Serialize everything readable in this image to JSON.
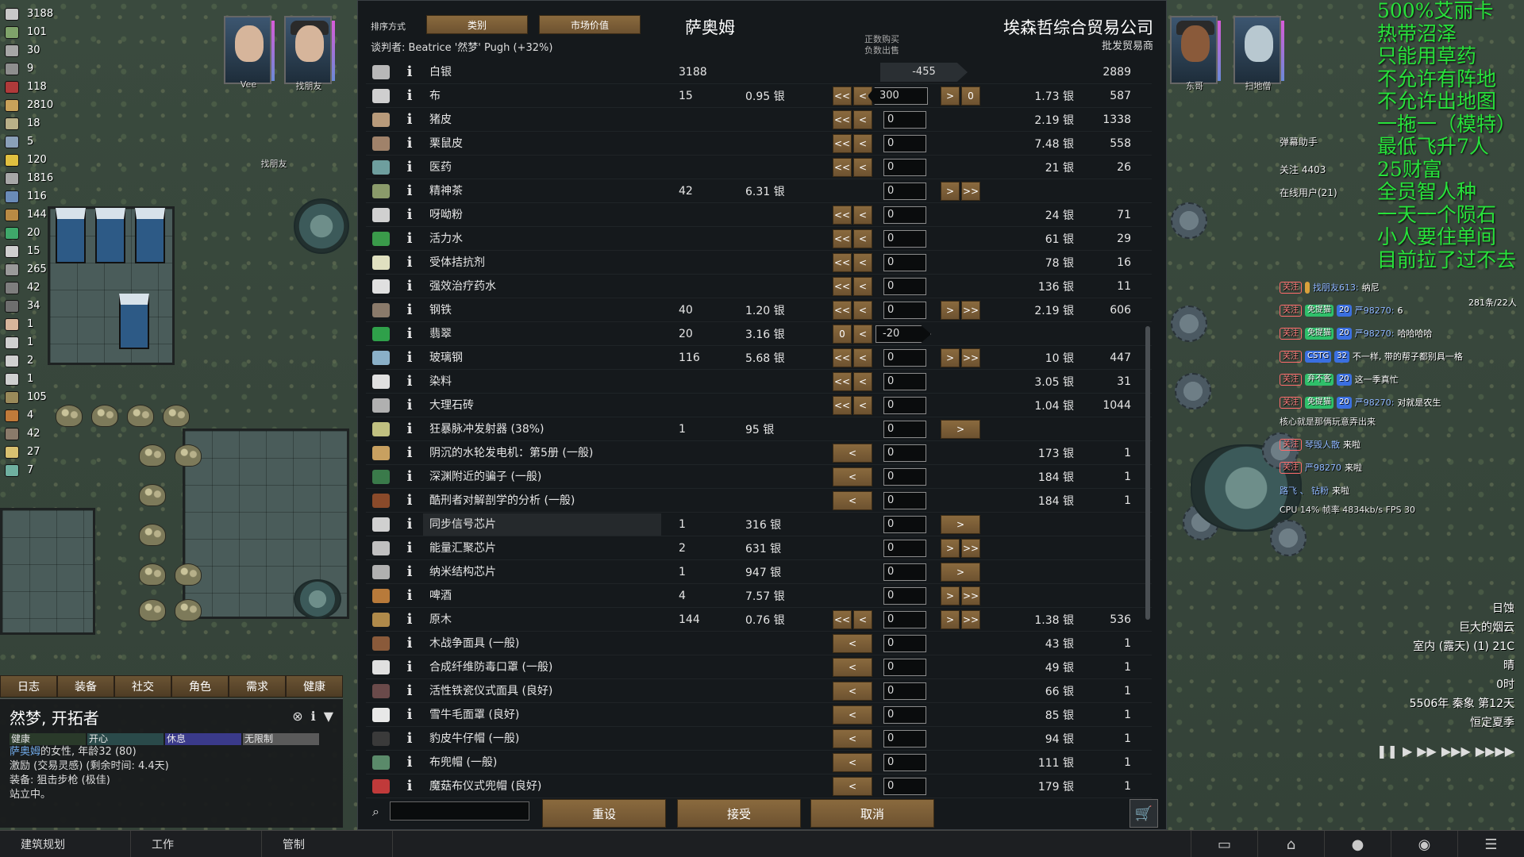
{
  "resources": [
    {
      "value": "3188",
      "color": "#c8c8c8"
    },
    {
      "value": "101",
      "color": "#7fa36a"
    },
    {
      "value": "30",
      "color": "#a6a6a6"
    },
    {
      "value": "9",
      "color": "#8e8e8e"
    },
    {
      "value": "118",
      "color": "#b03a3a"
    },
    {
      "value": "2810",
      "color": "#c9a25a"
    },
    {
      "value": "18",
      "color": "#b9b088"
    },
    {
      "value": "5",
      "color": "#8aa0b8"
    },
    {
      "value": "120",
      "color": "#e0c040"
    },
    {
      "value": "1816",
      "color": "#a7a7a7"
    },
    {
      "value": "116",
      "color": "#6a8bb8"
    },
    {
      "value": "144",
      "color": "#b98a44"
    },
    {
      "value": "20",
      "color": "#3fa86a"
    },
    {
      "value": "15",
      "color": "#cfcfcf"
    },
    {
      "value": "265",
      "color": "#9a9a9a"
    },
    {
      "value": "42",
      "color": "#7e7e7e"
    },
    {
      "value": "34",
      "color": "#6e6e6e"
    },
    {
      "value": "1",
      "color": "#d6b59b"
    },
    {
      "value": "1",
      "color": "#d0d0d0"
    },
    {
      "value": "2",
      "color": "#d0d0d0"
    },
    {
      "value": "1",
      "color": "#d0d0d0"
    },
    {
      "value": "105",
      "color": "#9a8a5a"
    },
    {
      "value": "4",
      "color": "#c07a3a"
    },
    {
      "value": "42",
      "color": "#8a7a6a"
    },
    {
      "value": "27",
      "color": "#d8c070"
    },
    {
      "value": "7",
      "color": "#6fb0a0"
    }
  ],
  "colonists_left": [
    {
      "name": "Vee"
    },
    {
      "name": "找朋友"
    }
  ],
  "colonists_right": [
    {
      "name": "东哥"
    },
    {
      "name": "扫地僧"
    }
  ],
  "map_label": "找朋友",
  "trade": {
    "sort_label": "排序方式",
    "sort_category": "类别",
    "sort_market": "市场价值",
    "negotiator": "谈判者: Beatrice '然梦' Pugh (+32%)",
    "left_title": "萨奥姆",
    "right_title": "埃森哲综合贸易公司",
    "right_sub": "批发贸易商",
    "hint_buy": "正数购买",
    "hint_sell": "负数出售",
    "currency": {
      "name": "白银",
      "count": "3188",
      "qty": "-455",
      "trader_count": "2889"
    },
    "rows": [
      {
        "name": "布",
        "count": "15",
        "price": "0.95 银",
        "qty": "300",
        "rprice": "1.73 银",
        "rcount": "587",
        "color": "#cfcfcf",
        "buttons": "full",
        "right_buttons": "one-zero",
        "qty_style": "pos"
      },
      {
        "name": "猪皮",
        "count": "",
        "price": "",
        "qty": "0",
        "rprice": "2.19 银",
        "rcount": "1338",
        "color": "#b89a7a",
        "buttons": "full",
        "right_buttons": "none"
      },
      {
        "name": "栗鼠皮",
        "count": "",
        "price": "",
        "qty": "0",
        "rprice": "7.48 银",
        "rcount": "558",
        "color": "#a0826a",
        "buttons": "full",
        "right_buttons": "none"
      },
      {
        "name": "医药",
        "count": "",
        "price": "",
        "qty": "0",
        "rprice": "21 银",
        "rcount": "26",
        "color": "#6e9e9e",
        "buttons": "full",
        "right_buttons": "none"
      },
      {
        "name": "精神茶",
        "count": "42",
        "price": "6.31 银",
        "qty": "0",
        "rprice": "",
        "rcount": "",
        "color": "#8a9a6a",
        "buttons": "none",
        "right_buttons": "two"
      },
      {
        "name": "呀呦粉",
        "count": "",
        "price": "",
        "qty": "0",
        "rprice": "24 银",
        "rcount": "71",
        "color": "#d0d0d0",
        "buttons": "full",
        "right_buttons": "none"
      },
      {
        "name": "活力水",
        "count": "",
        "price": "",
        "qty": "0",
        "rprice": "61 银",
        "rcount": "29",
        "color": "#3a9a4a",
        "buttons": "full",
        "right_buttons": "none"
      },
      {
        "name": "受体拮抗剂",
        "count": "",
        "price": "",
        "qty": "0",
        "rprice": "78 银",
        "rcount": "16",
        "color": "#e0e0c0",
        "buttons": "full",
        "right_buttons": "none"
      },
      {
        "name": "强效治疗药水",
        "count": "",
        "price": "",
        "qty": "0",
        "rprice": "136 银",
        "rcount": "11",
        "color": "#e0e0e0",
        "buttons": "full",
        "right_buttons": "none"
      },
      {
        "name": "钢铁",
        "count": "40",
        "price": "1.20 银",
        "qty": "0",
        "rprice": "2.19 银",
        "rcount": "606",
        "color": "#8a7a6a",
        "buttons": "full",
        "right_buttons": "two"
      },
      {
        "name": "翡翠",
        "count": "20",
        "price": "3.16 银",
        "qty": "-20",
        "rprice": "",
        "rcount": "",
        "color": "#2fa04a",
        "buttons": "zero-one",
        "right_buttons": "none",
        "qty_style": "neg"
      },
      {
        "name": "玻璃钢",
        "count": "116",
        "price": "5.68 银",
        "qty": "0",
        "rprice": "10 银",
        "rcount": "447",
        "color": "#8ab0c8",
        "buttons": "full",
        "right_buttons": "two"
      },
      {
        "name": "染料",
        "count": "",
        "price": "",
        "qty": "0",
        "rprice": "3.05 银",
        "rcount": "31",
        "color": "#e0e0e0",
        "buttons": "full",
        "right_buttons": "none"
      },
      {
        "name": "大理石砖",
        "count": "",
        "price": "",
        "qty": "0",
        "rprice": "1.04 银",
        "rcount": "1044",
        "color": "#b0b0b0",
        "buttons": "full",
        "right_buttons": "none"
      },
      {
        "name": "狂暴脉冲发射器 (38%)",
        "count": "1",
        "price": "95 银",
        "qty": "0",
        "rprice": "",
        "rcount": "",
        "color": "#c0c080",
        "buttons": "none",
        "right_buttons": "single"
      },
      {
        "name": "阴沉的水轮发电机：第5册 (一般)",
        "count": "",
        "price": "",
        "qty": "0",
        "rprice": "173 银",
        "rcount": "1",
        "color": "#c8a060",
        "buttons": "single",
        "right_buttons": "none"
      },
      {
        "name": "深渊附近的骗子 (一般)",
        "count": "",
        "price": "",
        "qty": "0",
        "rprice": "184 银",
        "rcount": "1",
        "color": "#3a7a4a",
        "buttons": "single",
        "right_buttons": "none"
      },
      {
        "name": "酷刑者对解剖学的分析 (一般)",
        "count": "",
        "price": "",
        "qty": "0",
        "rprice": "184 银",
        "rcount": "1",
        "color": "#8a4a2a",
        "buttons": "single",
        "right_buttons": "none"
      },
      {
        "name": "同步信号芯片",
        "count": "1",
        "price": "316 银",
        "qty": "0",
        "rprice": "",
        "rcount": "",
        "color": "#d0d0d0",
        "buttons": "none",
        "right_buttons": "single",
        "highlight": true
      },
      {
        "name": "能量汇聚芯片",
        "count": "2",
        "price": "631 银",
        "qty": "0",
        "rprice": "",
        "rcount": "",
        "color": "#c0c0c0",
        "buttons": "none",
        "right_buttons": "two"
      },
      {
        "name": "纳米结构芯片",
        "count": "1",
        "price": "947 银",
        "qty": "0",
        "rprice": "",
        "rcount": "",
        "color": "#b0b0b0",
        "buttons": "none",
        "right_buttons": "single"
      },
      {
        "name": "啤酒",
        "count": "4",
        "price": "7.57 银",
        "qty": "0",
        "rprice": "",
        "rcount": "",
        "color": "#b87a3a",
        "buttons": "none",
        "right_buttons": "two"
      },
      {
        "name": "原木",
        "count": "144",
        "price": "0.76 银",
        "qty": "0",
        "rprice": "1.38 银",
        "rcount": "536",
        "color": "#b08a4a",
        "buttons": "full",
        "right_buttons": "two"
      },
      {
        "name": "木战争面具 (一般)",
        "count": "",
        "price": "",
        "qty": "0",
        "rprice": "43 银",
        "rcount": "1",
        "color": "#8a5a3a",
        "buttons": "single",
        "right_buttons": "none"
      },
      {
        "name": "合成纤维防毒口罩 (一般)",
        "count": "",
        "price": "",
        "qty": "0",
        "rprice": "49 银",
        "rcount": "1",
        "color": "#e0e0e0",
        "buttons": "single",
        "right_buttons": "none"
      },
      {
        "name": "活性铁瓷仪式面具 (良好)",
        "count": "",
        "price": "",
        "qty": "0",
        "rprice": "66 银",
        "rcount": "1",
        "color": "#6a4a4a",
        "buttons": "single",
        "right_buttons": "none"
      },
      {
        "name": "雪牛毛面罩 (良好)",
        "count": "",
        "price": "",
        "qty": "0",
        "rprice": "85 银",
        "rcount": "1",
        "color": "#e8e8e8",
        "buttons": "single",
        "right_buttons": "none"
      },
      {
        "name": "豹皮牛仔帽 (一般)",
        "count": "",
        "price": "",
        "qty": "0",
        "rprice": "94 银",
        "rcount": "1",
        "color": "#3a3a3a",
        "buttons": "single",
        "right_buttons": "none"
      },
      {
        "name": "布兜帽 (一般)",
        "count": "",
        "price": "",
        "qty": "0",
        "rprice": "111 银",
        "rcount": "1",
        "color": "#5a8a6a",
        "buttons": "single",
        "right_buttons": "none"
      },
      {
        "name": "魔菇布仪式兜帽 (良好)",
        "count": "",
        "price": "",
        "qty": "0",
        "rprice": "179 银",
        "rcount": "1",
        "color": "#c03a3a",
        "buttons": "single",
        "right_buttons": "none"
      }
    ],
    "btn_reset": "重设",
    "btn_accept": "接受",
    "btn_cancel": "取消",
    "btn_left_all": "<<",
    "btn_left_one": "<",
    "btn_right_one": ">",
    "btn_right_all": ">>",
    "btn_zero": "0"
  },
  "inspect": {
    "tabs": [
      "日志",
      "装备",
      "社交",
      "角色",
      "需求",
      "健康"
    ],
    "name": "然梦, 开拓者",
    "needs": [
      {
        "label": "健康",
        "color": "#2a3a2a"
      },
      {
        "label": "开心",
        "color": "#2a4a4a"
      },
      {
        "label": "休息",
        "color": "#3a3a8a"
      },
      {
        "label": "无限制",
        "color": "#5a5a5a"
      }
    ],
    "line1_prefix": "萨奥姆",
    "line1_rest": "的女性, 年龄32 (80)",
    "line2": "激励 (交易灵感) (剩余时间: 4.4天)",
    "line3": "装备: 狙击步枪 (极佳)",
    "line4": "站立中。"
  },
  "mainbar": {
    "tabs": [
      "建筑规划",
      "工作",
      "管制"
    ]
  },
  "overlay_lines": [
    "500%艾丽卡",
    "热带沼泽",
    "只能用草药",
    "不允许有阵地",
    "不允许出地图",
    "一拖一（模特）",
    "最低飞升7人",
    "25财富",
    "全员智人种",
    "一天一个陨石",
    "小人要住单间",
    "目前拉了过不去"
  ],
  "chat": {
    "title": "弹幕助手",
    "follow": "关注 4403",
    "online": "在线用户(21)",
    "count_badge": "281条/22人",
    "messages": [
      {
        "chips": [
          {
            "t": "关注",
            "c": "red"
          },
          {
            "t": "",
            "c": "orange"
          }
        ],
        "user": "找朋友613:",
        "text": "纳尼"
      },
      {
        "chips": [
          {
            "t": "关注",
            "c": "red"
          },
          {
            "t": "免提猫",
            "c": "green"
          },
          {
            "t": "20",
            "c": "blue"
          }
        ],
        "user": "严98270:",
        "text": "6"
      },
      {
        "chips": [
          {
            "t": "关注",
            "c": "red"
          },
          {
            "t": "免提猫",
            "c": "green"
          },
          {
            "t": "20",
            "c": "blue"
          }
        ],
        "user": "严98270:",
        "text": "哈哈哈哈"
      },
      {
        "chips": [
          {
            "t": "关注",
            "c": "red"
          },
          {
            "t": "CSTG",
            "c": "blue"
          },
          {
            "t": "32",
            "c": "blue"
          }
        ],
        "user": "",
        "text": "不一样, 带的帮子都别具一格"
      },
      {
        "chips": [
          {
            "t": "关注",
            "c": "red"
          },
          {
            "t": "弃不客",
            "c": "green"
          },
          {
            "t": "20",
            "c": "blue"
          }
        ],
        "user": "",
        "text": "这一季真忙"
      },
      {
        "chips": [
          {
            "t": "关注",
            "c": "red"
          },
          {
            "t": "免提猫",
            "c": "green"
          },
          {
            "t": "20",
            "c": "blue"
          }
        ],
        "user": "严98270:",
        "text": "对就是农生"
      },
      {
        "chips": [
          {
            "t": "关注",
            "c": "red"
          }
        ],
        "user": "琴毁人散",
        "text": "来啦"
      },
      {
        "chips": [
          {
            "t": "关注",
            "c": "red"
          }
        ],
        "user": "严98270",
        "text": "来啦"
      },
      {
        "chips": [],
        "user": "路飞 、 钻粉",
        "text": "来啦"
      }
    ],
    "note1": "核心就是那俩玩意弄出来",
    "note2": "CPU 14%  帧率 4834kb/s FPS 30"
  },
  "weather": {
    "lines": [
      "日蚀",
      "巨大的烟云",
      "室内 (露天)  (1) 21C",
      "晴",
      "0时",
      "5506年 秦象 第12天",
      "恒定夏季"
    ]
  }
}
